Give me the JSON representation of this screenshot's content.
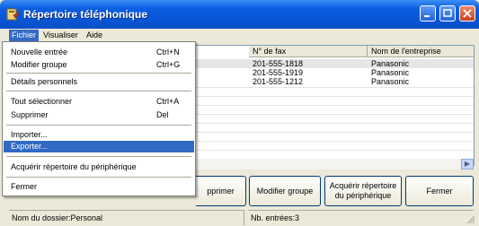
{
  "window": {
    "title": "Répertoire téléphonique"
  },
  "menubar": {
    "items": [
      "Fichier",
      "Visualiser",
      "Aide"
    ]
  },
  "table": {
    "columns": [
      "N° de fax",
      "Nom de l'entreprise"
    ],
    "rows": [
      {
        "fax": "201-555-1818",
        "company": "Panasonic"
      },
      {
        "fax": "201-555-1919",
        "company": "Panasonic"
      },
      {
        "fax": "201-555-1212",
        "company": "Panasonic"
      }
    ]
  },
  "file_menu": {
    "new_entry": {
      "label": "Nouvelle entrée",
      "shortcut": "Ctrl+N"
    },
    "modify_group": {
      "label": "Modifier groupe",
      "shortcut": "Ctrl+G"
    },
    "personal_details": {
      "label": "Détails personnels"
    },
    "select_all": {
      "label": "Tout sélectionner",
      "shortcut": "Ctrl+A"
    },
    "delete": {
      "label": "Supprimer",
      "shortcut": "Del"
    },
    "import": {
      "label": "Importer..."
    },
    "export": {
      "label": "Exporter..."
    },
    "acquire_device": {
      "label": "Acquérir répertoire du périphérique"
    },
    "close": {
      "label": "Fermer"
    }
  },
  "buttons": {
    "delete_partial": "pprimer",
    "modify_group": "Modifier groupe",
    "acquire_line1": "Acquérir répertoire",
    "acquire_line2": "du périphérique",
    "close": "Fermer"
  },
  "status": {
    "folder": "Nom du dossier:Personal",
    "entries": "Nb. entrées:3"
  }
}
